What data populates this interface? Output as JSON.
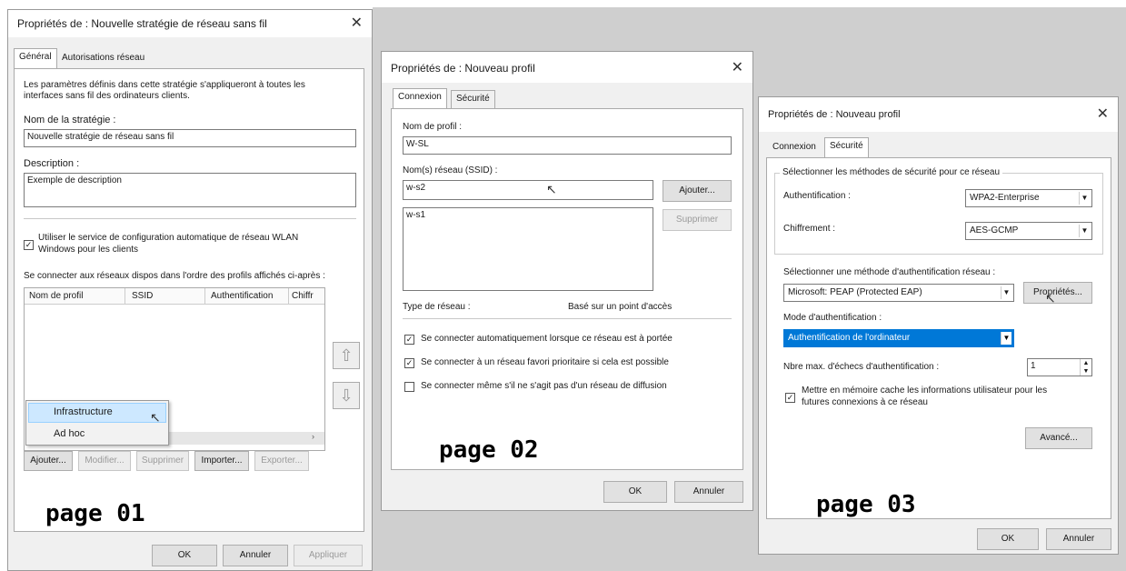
{
  "p1": {
    "title": "Propriétés de : Nouvelle stratégie de réseau sans fil",
    "tab_general": "Général",
    "tab_network": "Autorisations réseau",
    "intro": "Les paramètres définis dans cette stratégie s'appliqueront à toutes les",
    "intro2": "interfaces sans fil des ordinateurs clients.",
    "name_label": "Nom de la stratégie :",
    "name_value": "Nouvelle stratégie de réseau sans fil",
    "desc_label": "Description :",
    "desc_value": "Exemple de description",
    "wlan_check": "Utiliser le service de configuration automatique de réseau WLAN",
    "wlan_check2": "Windows pour les clients",
    "connect_label": "Se connecter aux réseaux dispos dans l'ordre des profils affichés ci-après :",
    "col_profile": "Nom de profil",
    "col_ssid": "SSID",
    "col_auth": "Authentification",
    "col_enc": "Chiffr",
    "menu_infra": "Infrastructure",
    "menu_adhoc": "Ad hoc",
    "btn_add": "Ajouter...",
    "btn_edit": "Modifier...",
    "btn_delete": "Supprimer",
    "btn_import": "Importer...",
    "btn_export": "Exporter...",
    "page_label": "page 01",
    "ok": "OK",
    "cancel": "Annuler",
    "apply": "Appliquer"
  },
  "p2": {
    "title": "Propriétés de : Nouveau profil",
    "tab_connection": "Connexion",
    "tab_security": "Sécurité",
    "profile_label": "Nom de profil :",
    "profile_value": "W-SL",
    "ssid_label": "Nom(s) réseau (SSID) :",
    "ssid_value": "w-s2",
    "btn_add": "Ajouter...",
    "ssid_list_item": "w-s1",
    "btn_delete": "Supprimer",
    "net_type_label": "Type de réseau :",
    "net_type_value": "Basé sur un point d'accès",
    "opt1": "Se connecter automatiquement lorsque ce réseau est à portée",
    "opt2": "Se connecter à un réseau favori prioritaire si cela est possible",
    "opt3": "Se connecter même s'il ne s'agit pas d'un réseau de diffusion",
    "page_label": "page 02",
    "ok": "OK",
    "cancel": "Annuler"
  },
  "p3": {
    "title": "Propriétés de : Nouveau profil",
    "tab_connection": "Connexion",
    "tab_security": "Sécurité",
    "group_label": "Sélectionner les méthodes de sécurité pour ce réseau",
    "auth_label": "Authentification :",
    "auth_value": "WPA2-Enterprise",
    "enc_label": "Chiffrement :",
    "enc_value": "AES-GCMP",
    "method_label": "Sélectionner une méthode d'authentification réseau :",
    "method_value": "Microsoft: PEAP (Protected EAP)",
    "btn_props": "Propriétés...",
    "mode_label": "Mode d'authentification :",
    "mode_value": "Authentification de l'ordinateur",
    "fail_label": "Nbre max. d'échecs d'authentification :",
    "fail_value": "1",
    "cache_check": "Mettre en mémoire cache les informations utilisateur pour les",
    "cache_check2": "futures connexions à ce réseau",
    "btn_advanced": "Avancé...",
    "page_label": "page 03",
    "ok": "OK",
    "cancel": "Annuler"
  }
}
